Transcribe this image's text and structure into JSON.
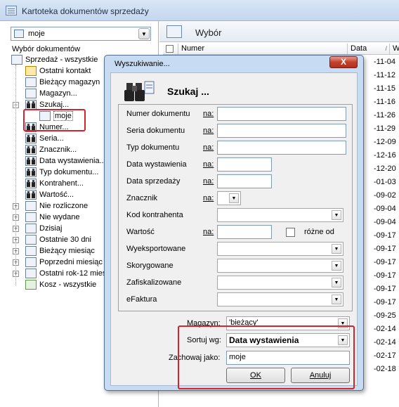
{
  "window": {
    "title": "Kartoteka dokumentów sprzedaży"
  },
  "left": {
    "combo_value": "moje",
    "section_label": "Wybór dokumentów",
    "tree": [
      {
        "label": "Sprzedaż - wszystkie",
        "icon": "list-icon"
      },
      {
        "label": "Ostatni kontakt",
        "icon": "star-icon"
      },
      {
        "label": "Bieżący magazyn",
        "icon": "list-icon"
      },
      {
        "label": "Magazyn...",
        "icon": "list-icon"
      },
      {
        "label": "Szukaj...",
        "icon": "binoculars-icon"
      },
      {
        "label": "moje",
        "icon": "list-icon"
      },
      {
        "label": "Numer...",
        "icon": "binoculars-icon"
      },
      {
        "label": "Seria...",
        "icon": "binoculars-icon"
      },
      {
        "label": "Znacznik...",
        "icon": "binoculars-icon"
      },
      {
        "label": "Data wystawienia...",
        "icon": "binoculars-icon"
      },
      {
        "label": "Typ dokumentu...",
        "icon": "binoculars-icon"
      },
      {
        "label": "Kontrahent...",
        "icon": "binoculars-icon"
      },
      {
        "label": "Wartość...",
        "icon": "binoculars-icon"
      },
      {
        "label": "Nie rozliczone",
        "icon": "list-icon"
      },
      {
        "label": "Nie wydane",
        "icon": "list-icon"
      },
      {
        "label": "Dzisiaj",
        "icon": "list-icon"
      },
      {
        "label": "Ostatnie 30 dni",
        "icon": "list-icon"
      },
      {
        "label": "Bieżący miesiąc",
        "icon": "list-icon"
      },
      {
        "label": "Poprzedni miesiąc",
        "icon": "list-icon"
      },
      {
        "label": "Ostatni rok-12 mies",
        "icon": "list-icon"
      },
      {
        "label": "Kosz - wszystkie",
        "icon": "recycle-bin-icon"
      }
    ]
  },
  "right": {
    "header": "Wybór",
    "columns": {
      "numer": "Numer",
      "data": "Data",
      "w": "W"
    },
    "row_dates": [
      "-11-04",
      "-11-12",
      "-11-15",
      "-11-16",
      "-11-26",
      "-11-29",
      "-12-09",
      "-12-16",
      "-12-20",
      "-01-03",
      "-09-02",
      "-09-04",
      "-09-04",
      "-09-17",
      "-09-17",
      "-09-17",
      "-09-17",
      "-09-17",
      "-09-17",
      "-09-25",
      "-02-14",
      "-02-14",
      "-02-17",
      "-02-18"
    ]
  },
  "dialog": {
    "title": "Wyszukiwanie...",
    "close": "X",
    "heading": "Szukaj ...",
    "na_label": "na:",
    "fields": {
      "numer_dokumentu": "Numer dokumentu",
      "seria_dokumentu": "Seria dokumentu",
      "typ_dokumentu": "Typ dokumentu",
      "data_wystawienia": "Data wystawienia",
      "data_sprzedazy": "Data sprzedaży",
      "znacznik": "Znacznik",
      "kod_kontrahenta": "Kod kontrahenta",
      "wartosc": "Wartość",
      "rozne_od": "różne od",
      "wyeksportowane": "Wyeksportowane",
      "skorygowane": "Skorygowane",
      "zafiskalizowane": "Zafiskalizowane",
      "efaktura": "eFaktura"
    },
    "magazyn_label": "Magazyn:",
    "magazyn_value": "'bieżący'",
    "sortuj_label": "Sortuj wg:",
    "sortuj_value": "Data wystawienia",
    "zachowaj_label": "Zachowaj jako:",
    "zachowaj_value": "moje",
    "ok": "OK",
    "anuluj": "Anuluj"
  },
  "colors": {
    "highlight_border": "#d2242a",
    "dialog_frame": "#c7dbf2",
    "close_button": "#c2402b"
  }
}
